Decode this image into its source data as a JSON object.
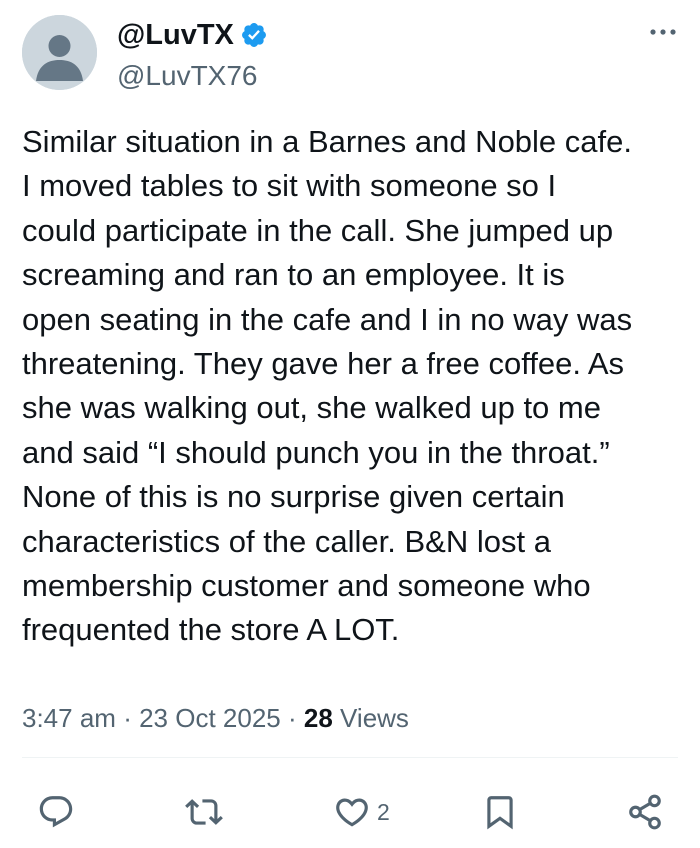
{
  "author": {
    "display_name": "@LuvTX",
    "handle": "@LuvTX76",
    "verified": true,
    "verified_color": "#1d9bf0"
  },
  "tweet": {
    "lines": [
      "Similar situation in a Barnes and Noble cafe.",
      "I moved tables to sit with someone so I",
      "could participate in the call.  She jumped up",
      "screaming and ran to an employee.  It is",
      "open seating in the cafe and I in no way was",
      "threatening.  They gave her a free coffee.  As",
      "she was walking out, she walked up to me",
      "and said “I should punch you in the throat.”",
      "None of this is no surprise given certain",
      "characteristics of the caller.  B&N lost a",
      "membership customer and someone who",
      "frequented the store A LOT."
    ]
  },
  "meta": {
    "time": "3:47 am",
    "separator": "·",
    "date": "23 Oct 2025",
    "views_count": "28",
    "views_label": "Views"
  },
  "actions": {
    "reply_icon": "reply-icon",
    "retweet_icon": "retweet-icon",
    "like_icon": "heart-icon",
    "like_count": "2",
    "bookmark_icon": "bookmark-icon",
    "share_icon": "share-icon"
  },
  "colors": {
    "text": "#0f1419",
    "secondary": "#536471",
    "avatar_bg": "#ccd6dd",
    "avatar_fg": "#657786"
  }
}
